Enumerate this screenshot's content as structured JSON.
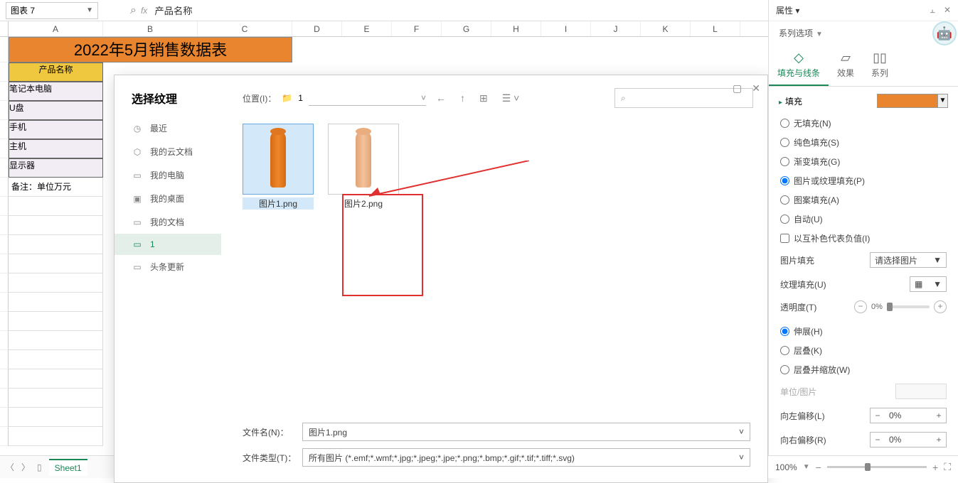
{
  "topbar": {
    "namebox": "图表 7",
    "formula": "产品名称"
  },
  "columns": [
    "A",
    "B",
    "C",
    "D",
    "E",
    "F",
    "G",
    "H",
    "I",
    "J",
    "K",
    "L"
  ],
  "sheet": {
    "title": "2022年5月销售数据表",
    "header": "产品名称",
    "rows": [
      "笔记本电脑",
      "U盘",
      "手机",
      "主机",
      "显示器"
    ],
    "note": "备注：单位万元"
  },
  "dialog": {
    "title": "选择纹理",
    "side": {
      "recent": "最近",
      "cloud": "我的云文档",
      "pc": "我的电脑",
      "desktop": "我的桌面",
      "docs": "我的文档",
      "folder1": "1",
      "news": "头条更新"
    },
    "path_label": "位置(I)：",
    "path_value": "1",
    "files": [
      {
        "name": "图片1.png"
      },
      {
        "name": "图片2.png"
      }
    ],
    "filename_label": "文件名(N)：",
    "filename_value": "图片1.png",
    "filetype_label": "文件类型(T)：",
    "filetype_value": "所有图片 (*.emf;*.wmf;*.jpg;*.jpeg;*.jpe;*.png;*.bmp;*.gif;*.tif;*.tiff;*.svg)"
  },
  "panel": {
    "head": "属性 ▾",
    "series_opt": "系列选项",
    "tabs": {
      "fill": "填充与线条",
      "effect": "效果",
      "series": "系列"
    },
    "fill_section": "填充",
    "fill_options": {
      "none": "无填充(N)",
      "solid": "纯色填充(S)",
      "gradient": "渐变填充(G)",
      "picture": "图片或纹理填充(P)",
      "pattern": "图案填充(A)",
      "auto": "自动(U)"
    },
    "invert_neg": "以互补色代表负值(I)",
    "pic_fill_label": "图片填充",
    "pic_fill_value": "请选择图片",
    "texture_label": "纹理填充(U)",
    "opacity_label": "透明度(T)",
    "opacity_value": "0%",
    "stretch": "伸展(H)",
    "stack": "层叠(K)",
    "stack_scale": "层叠并缩放(W)",
    "unit_label": "单位/图片",
    "offset_left_label": "向左偏移(L)",
    "offset_left_value": "0%",
    "offset_right_label": "向右偏移(R)",
    "offset_right_value": "0%"
  },
  "sheet_tab": "Sheet1",
  "zoom": "100%"
}
